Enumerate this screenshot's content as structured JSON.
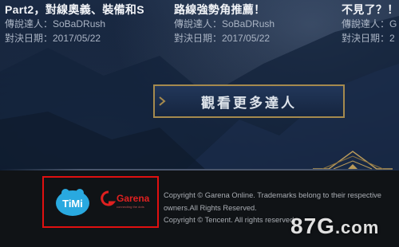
{
  "cards": [
    {
      "title": "Part2，對線奧義、裝備和S",
      "author_line": "傳說達人：SoBaDRush",
      "date_line": "對決日期：2017/05/22"
    },
    {
      "title": "路線強勢角推薦！",
      "author_line": "傳說達人：SoBaDRush",
      "date_line": "對決日期：2017/05/22"
    },
    {
      "title": "不見了？！G",
      "author_line": "傳說達人：G",
      "date_line": "對決日期：2"
    }
  ],
  "more_button": {
    "label": "觀看更多達人"
  },
  "footer": {
    "logos": {
      "timi": "TiMi",
      "garena": "Garena",
      "garena_tagline": "connecting the dots"
    },
    "copyright": [
      "Copyright © Garena Online. Trademarks belong to their respective",
      "owners.All Rights Reserved.",
      "Copyright © Tencent. All rights reserved."
    ]
  },
  "watermark": {
    "main": "87G",
    "suffix": ".com"
  },
  "colors": {
    "accent_gold": "#a58a4e",
    "highlight_border": "#e01010",
    "timi_blue": "#29a9e0",
    "garena_red": "#e02020"
  }
}
